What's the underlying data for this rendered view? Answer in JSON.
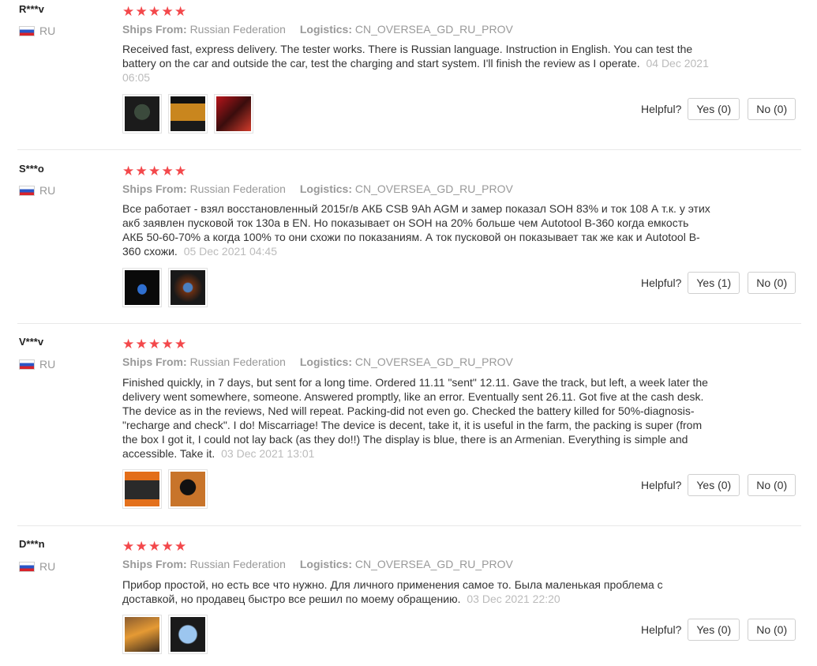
{
  "labels": {
    "ships_from": "Ships From:",
    "logistics": "Logistics:",
    "helpful": "Helpful?",
    "star_glyph": "★"
  },
  "colors": {
    "star": "#f3484b",
    "meta": "#999999",
    "date": "#bbbbbb"
  },
  "reviews": [
    {
      "user": "R***v",
      "country": "RU",
      "rating": 5,
      "ships_from": "Russian Federation",
      "logistics": "CN_OVERSEA_GD_RU_PROV",
      "text": "Received fast, express delivery. The tester works. There is Russian language. Instruction in English. You can test the battery on the car and outside the car, test the charging and start system. I'll finish the review as I operate.",
      "date": "04 Dec 2021 06:05",
      "yes": "Yes (0)",
      "no": "No (0)",
      "thumbs": [
        "tester-photo",
        "tester-photo",
        "tester-photo"
      ]
    },
    {
      "user": "S***o",
      "country": "RU",
      "rating": 5,
      "ships_from": "Russian Federation",
      "logistics": "CN_OVERSEA_GD_RU_PROV",
      "text": "Все работает - взял восстановленный 2015г/в АКБ CSB 9Ah AGM и замер показал SOH 83% и ток 108 А т.к. у этих акб заявлен пусковой ток 130а в EN. Но показывает он SOH на 20% больше чем Autotool B-360 когда емкость АКБ 50-60-70% а когда 100% то они схожи по показаниям. А ток пусковой он показывает так же как и Autotool B-360 схожи.",
      "date": "05 Dec 2021 04:45",
      "yes": "Yes (1)",
      "no": "No (0)",
      "thumbs": [
        "tester-photo",
        "tester-photo"
      ]
    },
    {
      "user": "V***v",
      "country": "RU",
      "rating": 5,
      "ships_from": "Russian Federation",
      "logistics": "CN_OVERSEA_GD_RU_PROV",
      "text": "Finished quickly, in 7 days, but sent for a long time. Ordered 11.11 \"sent\" 12.11. Gave the track, but left, a week later the delivery went somewhere, someone. Answered promptly, like an error. Eventually sent 26.11. Got five at the cash desk. The device as in the reviews, Ned will repeat. Packing-did not even go. Checked the battery killed for 50%-diagnosis-\"recharge and check\". I do! Miscarriage! The device is decent, take it, it is useful in the farm, the packing is super (from the box I got it, I could not lay back (as they do!!) The display is blue, there is an Armenian. Everything is simple and accessible. Take it.",
      "date": "03 Dec 2021 13:01",
      "yes": "Yes (0)",
      "no": "No (0)",
      "thumbs": [
        "tester-photo",
        "tester-photo"
      ]
    },
    {
      "user": "D***n",
      "country": "RU",
      "rating": 5,
      "ships_from": "Russian Federation",
      "logistics": "CN_OVERSEA_GD_RU_PROV",
      "text": "Прибор простой, но есть все что нужно. Для личного применения самое то. Была маленькая проблема с доставкой, но продавец быстро все решил по моему обращению.",
      "date": "03 Dec 2021 22:20",
      "yes": "Yes (0)",
      "no": "No (0)",
      "thumbs": [
        "tester-photo",
        "tester-photo"
      ]
    }
  ]
}
